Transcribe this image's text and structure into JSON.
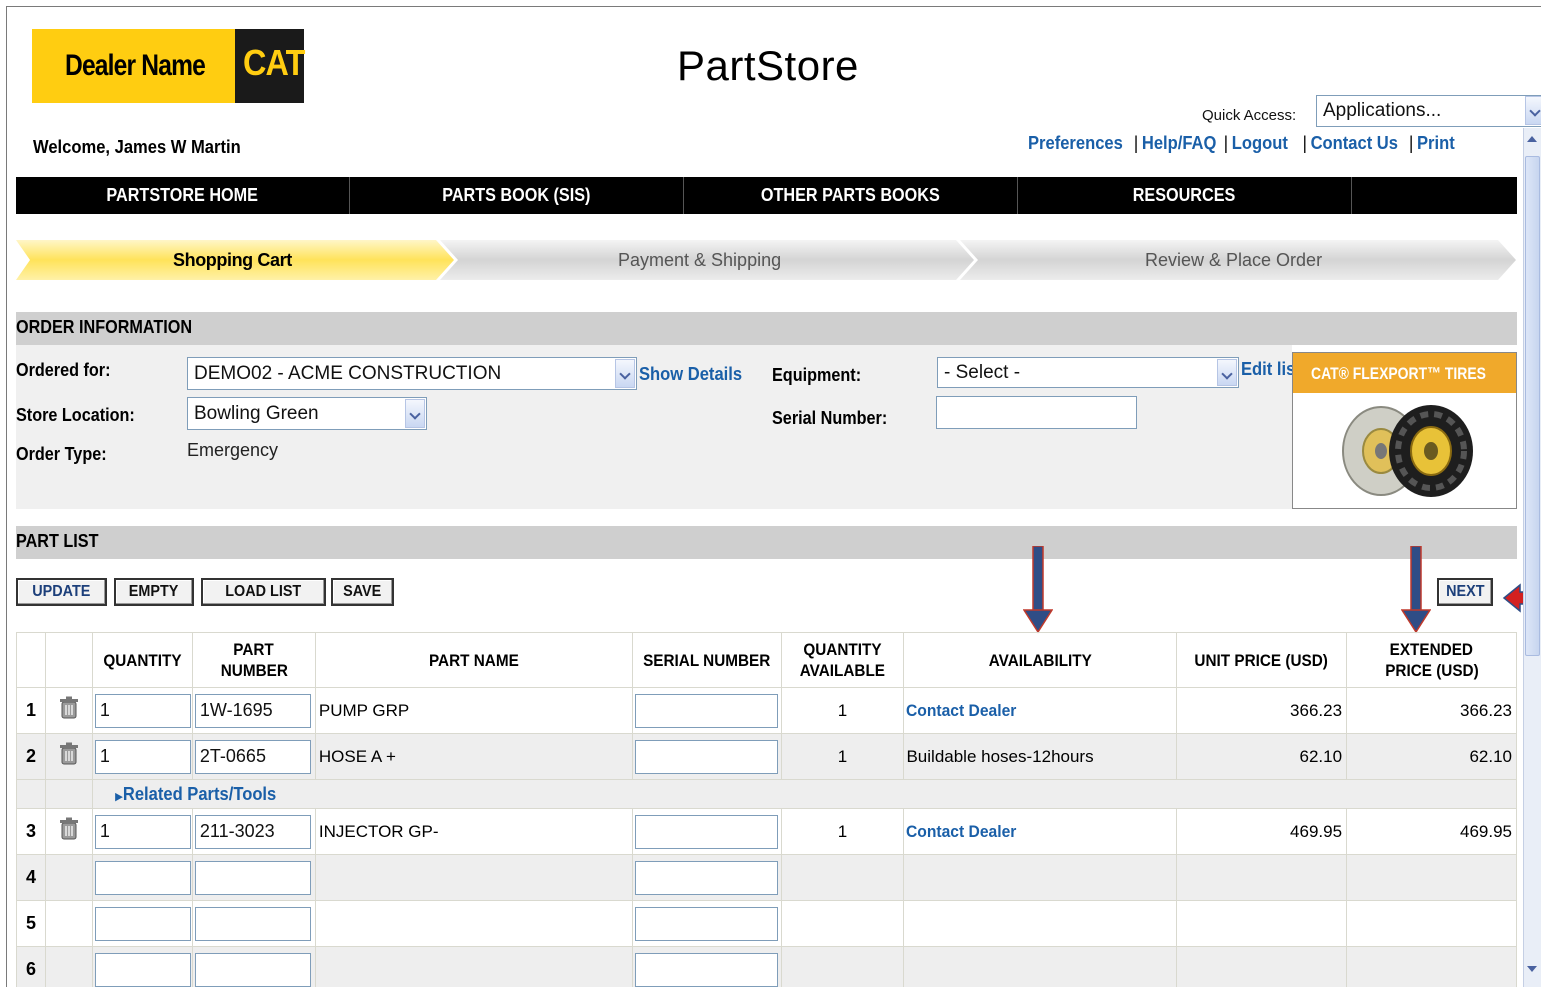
{
  "logo": {
    "dealer_name": "Dealer Name",
    "brand": "CAT"
  },
  "app_title": "PartStore",
  "quick_access": {
    "label": "Quick Access:",
    "value": "Applications..."
  },
  "welcome": "Welcome, James W Martin",
  "top_links": [
    "Preferences",
    "Help/FAQ",
    "Logout",
    "Contact Us",
    "Print"
  ],
  "nav": [
    "PARTSTORE HOME",
    "PARTS BOOK (SIS)",
    "OTHER PARTS BOOKS",
    "RESOURCES"
  ],
  "steps": [
    "Shopping Cart",
    "Payment & Shipping",
    "Review & Place Order"
  ],
  "order_info": {
    "header": "ORDER INFORMATION",
    "ordered_for_label": "Ordered for:",
    "ordered_for_value": "DEMO02 - ACME CONSTRUCTION",
    "show_details": "Show Details",
    "store_location_label": "Store Location:",
    "store_location_value": "Bowling Green",
    "order_type_label": "Order Type:",
    "order_type_value": "Emergency",
    "equipment_label": "Equipment:",
    "equipment_value": "- Select -",
    "edit_list": "Edit lis",
    "serial_number_label": "Serial Number:"
  },
  "ad": {
    "text": "CAT® FLEXPORT™ TIRES"
  },
  "part_list": {
    "header": "PART LIST",
    "buttons": {
      "update": "UPDATE",
      "empty": "EMPTY",
      "load_list": "LOAD LIST",
      "save": "SAVE",
      "next": "NEXT"
    },
    "columns": {
      "quantity": "QUANTITY",
      "part_number_1": "PART",
      "part_number_2": "NUMBER",
      "part_name": "PART NAME",
      "serial_number": "SERIAL NUMBER",
      "qty_avail_1": "QUANTITY",
      "qty_avail_2": "AVAILABLE",
      "availability": "AVAILABILITY",
      "unit_price": "UNIT PRICE (USD)",
      "ext_price_1": "EXTENDED",
      "ext_price_2": "PRICE (USD)"
    },
    "rows": [
      {
        "n": "1",
        "qty": "1",
        "part_number": "1W-1695",
        "part_name": "PUMP GRP",
        "qty_avail": "1",
        "availability": "Contact Dealer",
        "unit": "366.23",
        "ext": "366.23"
      },
      {
        "n": "2",
        "qty": "1",
        "part_number": "2T-0665",
        "part_name": "HOSE A +",
        "qty_avail": "1",
        "availability": "Buildable hoses-12hours",
        "unit": "62.10",
        "ext": "62.10"
      },
      {
        "n": "3",
        "qty": "1",
        "part_number": "211-3023",
        "part_name": "INJECTOR GP-",
        "qty_avail": "1",
        "availability": "Contact Dealer",
        "unit": "469.95",
        "ext": "469.95"
      },
      {
        "n": "4"
      },
      {
        "n": "5"
      },
      {
        "n": "6"
      }
    ],
    "related_link": "Related Parts/Tools"
  },
  "colors": {
    "cat_yellow": "#ffcd11",
    "link_blue": "#1a5fa8",
    "nav_black": "#000000",
    "callout_arrow": "#2f4d86"
  }
}
